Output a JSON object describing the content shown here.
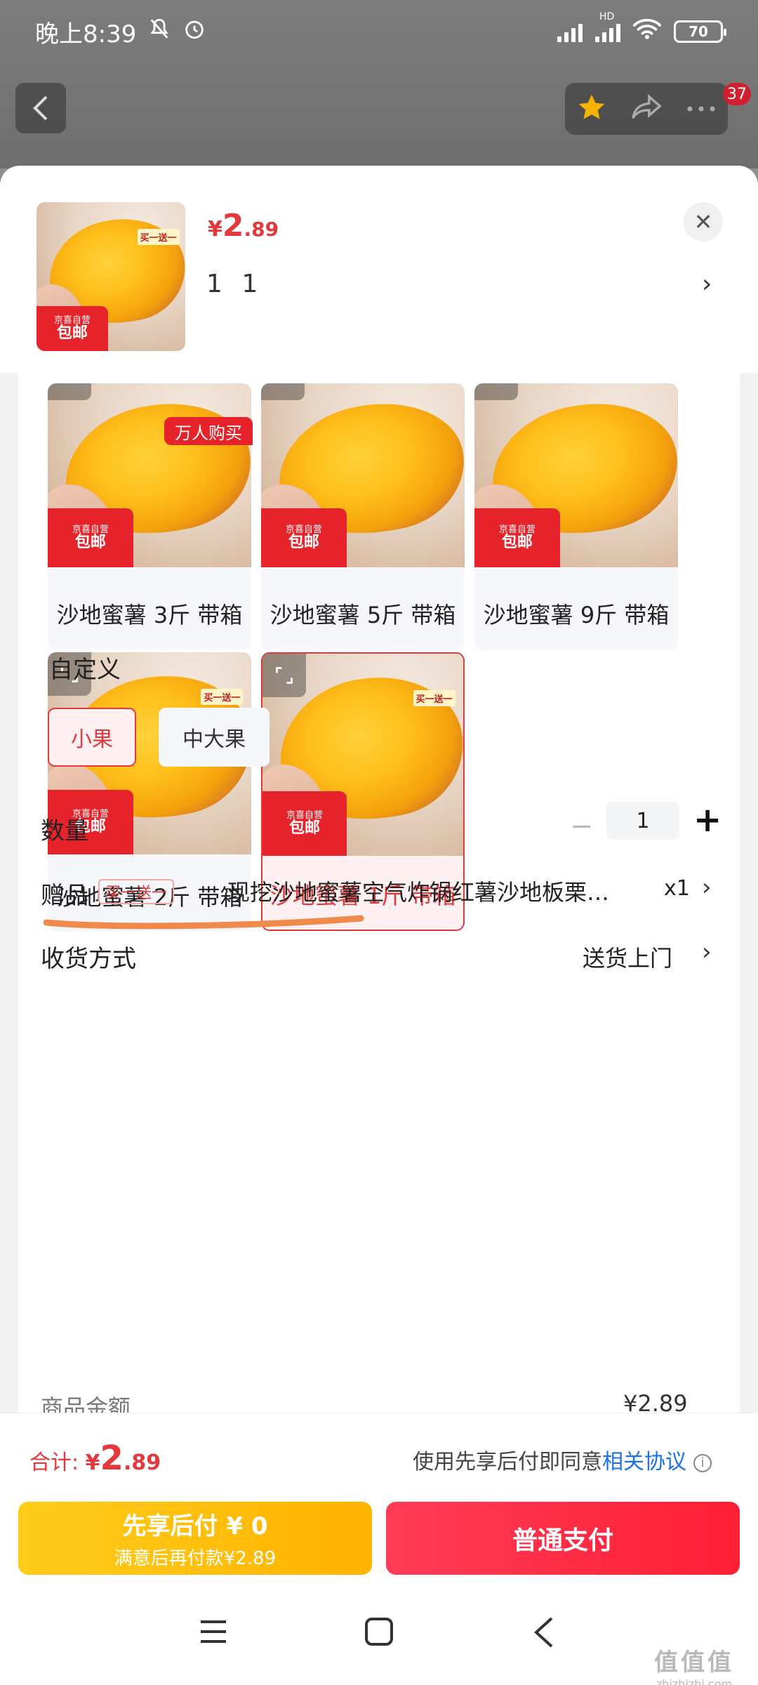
{
  "status_bar": {
    "time": "晚上8:39",
    "network": "HD",
    "battery": "70"
  },
  "header": {
    "badge_count": "37"
  },
  "sheet_header": {
    "price_currency": "¥",
    "price_integer": "2",
    "price_decimal": ".89",
    "selected_quantity": "1 1",
    "image_promo": "买一送一",
    "image_tag_line1": "京喜自营",
    "image_tag_line2": "包邮"
  },
  "sku_options": [
    {
      "label": "沙地蜜薯 3斤 带箱",
      "selected": false
    },
    {
      "label": "沙地蜜薯 5斤 带箱",
      "selected": false
    },
    {
      "label": "沙地蜜薯 9斤 带箱",
      "selected": false
    },
    {
      "label": "沙地蜜薯 2斤 带箱",
      "selected": false
    },
    {
      "label": "沙地蜜薯 1斤 带箱",
      "selected": true
    }
  ],
  "sku_image_tag": {
    "line1": "京喜自营",
    "line2": "包邮",
    "promo": "买一送一"
  },
  "hot_badge": "万人购买",
  "custom": {
    "title": "自定义",
    "options": [
      "小果",
      "中大果"
    ],
    "selected": "小果"
  },
  "quantity": {
    "label": "数量",
    "value": "1",
    "minus": "−",
    "plus": "+"
  },
  "gift": {
    "label": "赠品",
    "tag": "买一送一",
    "text": "现挖沙地蜜薯空气炸锅红薯沙地板栗…",
    "count": "x1"
  },
  "shipping": {
    "label": "收货方式",
    "value": "送货上门"
  },
  "amount": {
    "label": "商品金额",
    "value": "¥2.89"
  },
  "bottom": {
    "total_label": "合计: ",
    "total_currency": "¥",
    "total_integer": "2",
    "total_decimal": ".89",
    "agree_text": "使用先享后付即同意",
    "agree_link": "相关协议",
    "info_icon": "i",
    "pay_later_line1": "先享后付 ¥ 0",
    "pay_later_line2": "满意后再付款¥2.89",
    "pay_normal": "普通支付"
  },
  "watermark": {
    "text": "值值值",
    "url": "zhizhizhi.com"
  },
  "colors": {
    "accent": "#e4393c",
    "pay_later": "#ffbf10",
    "pay_normal": "#ff2d46",
    "link": "#1a73e8"
  }
}
